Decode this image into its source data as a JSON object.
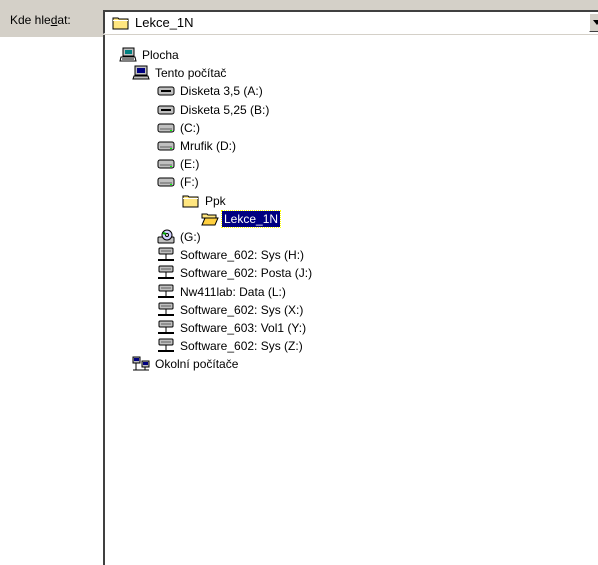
{
  "look_in": {
    "label_pre": "Kde hle",
    "label_accel": "d",
    "label_post": "at:",
    "selected": "Lekce_1N"
  },
  "tree": [
    {
      "label": "Plocha",
      "icon": "desktop-icon",
      "level": 0
    },
    {
      "label": "Tento počítač",
      "icon": "computer-icon",
      "level": 1
    },
    {
      "label": "Disketa 3,5 (A:)",
      "icon": "floppy-drive-icon",
      "level": 2
    },
    {
      "label": "Disketa 5,25 (B:)",
      "icon": "floppy-drive-icon",
      "level": 2
    },
    {
      "label": "(C:)",
      "icon": "hard-drive-icon",
      "level": 2
    },
    {
      "label": "Mrufik (D:)",
      "icon": "hard-drive-icon",
      "level": 2
    },
    {
      "label": "(E:)",
      "icon": "hard-drive-icon",
      "level": 2
    },
    {
      "label": "(F:)",
      "icon": "hard-drive-icon",
      "level": 2
    },
    {
      "label": "Ppk",
      "icon": "folder-icon",
      "level": 3
    },
    {
      "label": "Lekce_1N",
      "icon": "open-folder-icon",
      "level": 4,
      "selected": true
    },
    {
      "label": "(G:)",
      "icon": "cdrom-drive-icon",
      "level": 2
    },
    {
      "label": "Software_602: Sys (H:)",
      "icon": "network-drive-icon",
      "level": 2
    },
    {
      "label": "Software_602: Posta (J:)",
      "icon": "network-drive-icon",
      "level": 2
    },
    {
      "label": "Nw411lab: Data (L:)",
      "icon": "network-drive-icon",
      "level": 2
    },
    {
      "label": "Software_602: Sys (X:)",
      "icon": "network-drive-icon",
      "level": 2
    },
    {
      "label": "Software_603: Vol1 (Y:)",
      "icon": "network-drive-icon",
      "level": 2
    },
    {
      "label": "Software_602: Sys (Z:)",
      "icon": "network-drive-icon",
      "level": 2
    },
    {
      "label": "Okolní počítače",
      "icon": "network-neighborhood-icon",
      "level": 1
    }
  ]
}
